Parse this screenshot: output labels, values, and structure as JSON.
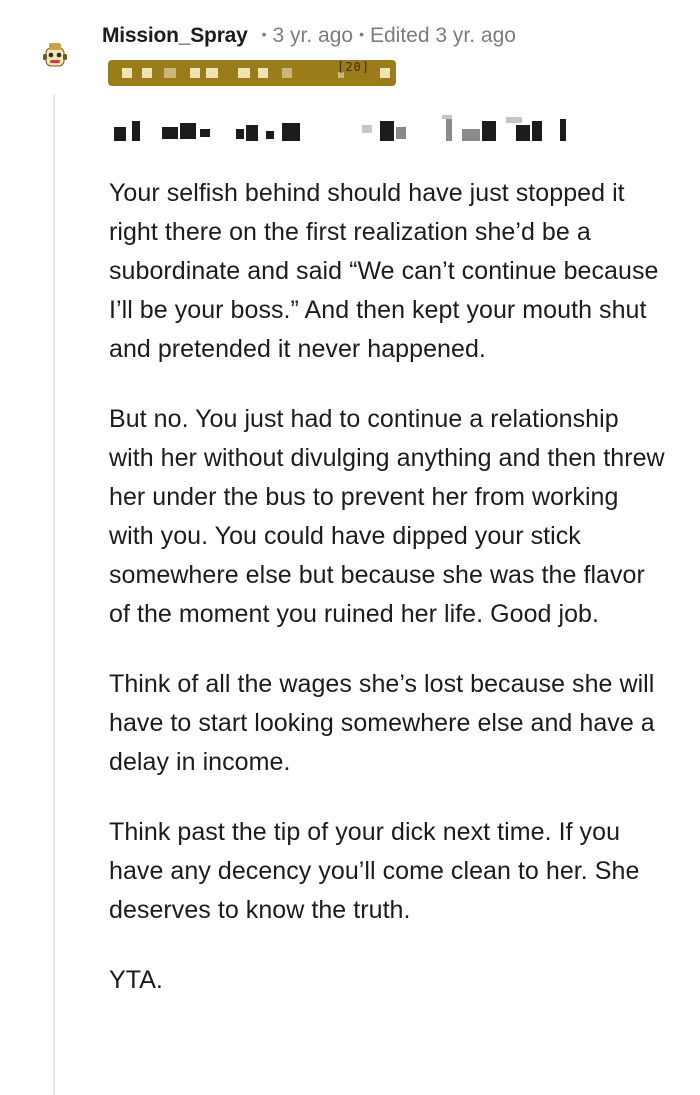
{
  "comment": {
    "author": "Mission_Spray",
    "posted": "3 yr. ago",
    "edited": "Edited 3 yr. ago",
    "flair_partial": "[20]",
    "paragraphs": [
      "Your selfish behind should have just stopped it right there on the first realization she’d be a subordinate and said “We can’t continue because I’ll be your boss.” And then kept your mouth shut and pretended it never happened.",
      "But no. You just had to continue a relationship with her without divulging anything and then threw her under the bus to prevent her from working with you. You could have dipped your stick somewhere else but because she was the flavor of the moment you ruined her life. Good job.",
      "Think of all the wages she’s lost because she will have to start looking somewhere else and have a delay in income.",
      "Think past the tip of your dick next time. If you have any decency you’ll come clean to her. She deserves to know the truth.",
      "YTA."
    ]
  },
  "colors": {
    "flair_bg": "#9a7d1a",
    "meta_text": "#7c7c7c",
    "thread_line": "#e4e6e8"
  },
  "icons": {
    "avatar": "snoo-avatar"
  }
}
